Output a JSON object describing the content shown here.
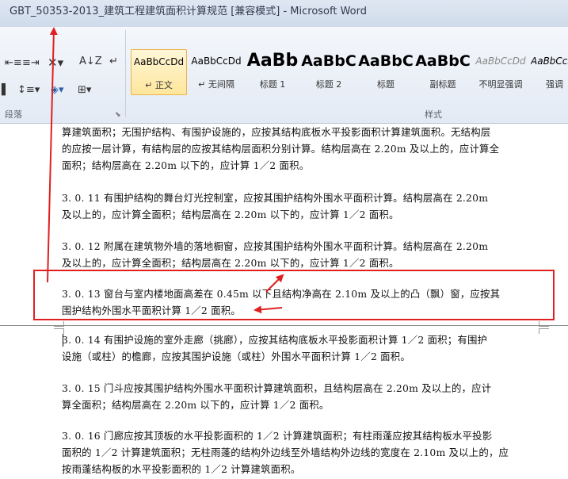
{
  "window": {
    "title": "GBT_50353-2013_建筑工程建筑面积计算规范 [兼容模式]  -  Microsoft Word"
  },
  "ribbon": {
    "paragraph_group_label": "段落",
    "styles_group_label": "样式",
    "styles": [
      {
        "sample": "AaBbCcDd",
        "name": "↵ 正文",
        "active": true
      },
      {
        "sample": "AaBbCcDd",
        "name": "↵ 无间隔",
        "active": false
      },
      {
        "sample": "AaBb",
        "name": "标题 1",
        "active": false
      },
      {
        "sample": "AaBbC",
        "name": "标题 2",
        "active": false
      },
      {
        "sample": "AaBbC",
        "name": "标题",
        "active": false
      },
      {
        "sample": "AaBbC",
        "name": "副标题",
        "active": false
      },
      {
        "sample": "AaBbCcDd",
        "name": "不明显强调",
        "active": false
      },
      {
        "sample": "AaBbCcDd",
        "name": "强调",
        "active": false
      }
    ]
  },
  "document": {
    "paragraphs": [
      {
        "lines": [
          "算建筑面积；无围护结构、有围护设施的，应按其结构底板水平投影面积计算建筑面积。无结构层",
          "的应按一层计算，有结构层的应按其结构层面积分别计算。结构层高在 2.20m 及以上的，应计算全",
          "面积；结构层高在 2.20m 以下的，应计算 1／2 面积。"
        ]
      },
      {
        "lines": [
          "3. 0. 11  有围护结构的舞台灯光控制室，应按其围护结构外围水平面积计算。结构层高在 2.20m",
          "及以上的，应计算全面积；结构层高在 2.20m 以下的，应计算 1／2 面积。"
        ]
      },
      {
        "lines": [
          "3. 0. 12  附属在建筑物外墙的落地橱窗，应按其围护结构外围水平面积计算。结构层高在 2.20m",
          "及以上的，应计算全面积；结构层高在 2.20m 以下的，应计算 1／2 面积。"
        ]
      },
      {
        "lines": [
          "3. 0. 13  窗台与室内楼地面高差在 0.45m 以下且结构净高在 2.10m 及以上的凸（飘）窗，应按其",
          "围护结构外围水平面积计算 1／2 面积。"
        ]
      },
      {
        "lines": [
          "3. 0. 14  有围护设施的室外走廊（挑廊），应按其结构底板水平投影面积计算 1／2 面积；有围护",
          "设施（或柱）的檐廊，应按其围护设施（或柱）外围水平面积计算 1／2 面积。"
        ]
      },
      {
        "lines": [
          "3. 0. 15  门斗应按其围护结构外围水平面积计算建筑面积，且结构层高在 2.20m 及以上的，应计",
          "算全面积；结构层高在 2.20m 以下的，应计算 1／2 面积。"
        ]
      },
      {
        "lines": [
          "3. 0. 16  门廊应按其顶板的水平投影面积的 1／2 计算建筑面积；有柱雨蓬应按其结构板水平投影",
          "面积的 1／2 计算建筑面积；无柱雨蓬的结构外边线至外墙结构外边线的宽度在 2.10m 及以上的，应",
          "按雨蓬结构板的水平投影面积的 1／2 计算建筑面积。"
        ]
      }
    ]
  },
  "annotation": {
    "color": "#e02020"
  }
}
